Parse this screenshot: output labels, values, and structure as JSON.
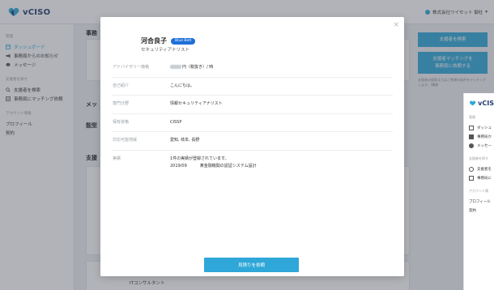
{
  "header": {
    "logo_text": "vCISO",
    "company": "株式会社ワイセット 御社",
    "caret": "▾"
  },
  "sidebar": {
    "section_home": "管理",
    "items_home": [
      {
        "label": "ダッシュボード",
        "icon": "dashboard-icon"
      },
      {
        "label": "事務局からのお知らせ",
        "icon": "megaphone-icon"
      },
      {
        "label": "メッセージ",
        "icon": "chat-icon"
      }
    ],
    "section_search": "支援者を探す",
    "items_search": [
      {
        "label": "支援者を検索",
        "icon": "search-icon"
      },
      {
        "label": "事務局にマッチング依頼",
        "icon": "list-icon"
      }
    ],
    "section_account": "アカウント情報",
    "items_account": [
      {
        "label": "プロフィール"
      },
      {
        "label": "契約"
      }
    ]
  },
  "main": {
    "heading_1": "事務",
    "heading_2": "メッ",
    "heading_3": "能型",
    "heading_4": "支援",
    "bottom_text": "ITコンサルタント",
    "right_button_1": "支援者を検索",
    "right_button_2_line1": "支援者マッチングを",
    "right_button_2_line2": "事務局に依頼する",
    "right_note": "支援者の検索またはご希望の条件をマッチングします。(事務"
  },
  "duplicate": {
    "logo_text": "vCIS",
    "section_home": "管理",
    "items_home": [
      "ダッシュ",
      "事務局か",
      "メッセー"
    ],
    "section_search": "支援者を探す",
    "items_search": [
      "支援者を",
      "事務局に"
    ],
    "section_account": "アカウント情",
    "items_account": [
      "プロフィール",
      "契約"
    ]
  },
  "modal": {
    "close": "×",
    "name": "河合良子",
    "badge": "Blue Belt",
    "title": "セキュリティアナリスト",
    "rows": [
      {
        "key": "アドバイザリー価格",
        "value": "円（税抜き）/ 時"
      },
      {
        "key": "自己紹介",
        "value": "こんにちは。"
      },
      {
        "key": "専門分野",
        "value": "情報セキュリティアナリスト"
      },
      {
        "key": "保有資格",
        "value": "CISSP"
      },
      {
        "key": "対応可能地域",
        "value": "愛知, 岐阜, 長野"
      },
      {
        "key": "実績",
        "value": "1件の実績が登録されています。"
      }
    ],
    "record": {
      "date": "2019/09",
      "desc": "某金融機関の認証システム設計"
    },
    "cta": "見積りを依頼"
  },
  "colors": {
    "accent": "#2fa7d8",
    "badge": "#1e6fd8",
    "brand": "#1f3b6e"
  }
}
